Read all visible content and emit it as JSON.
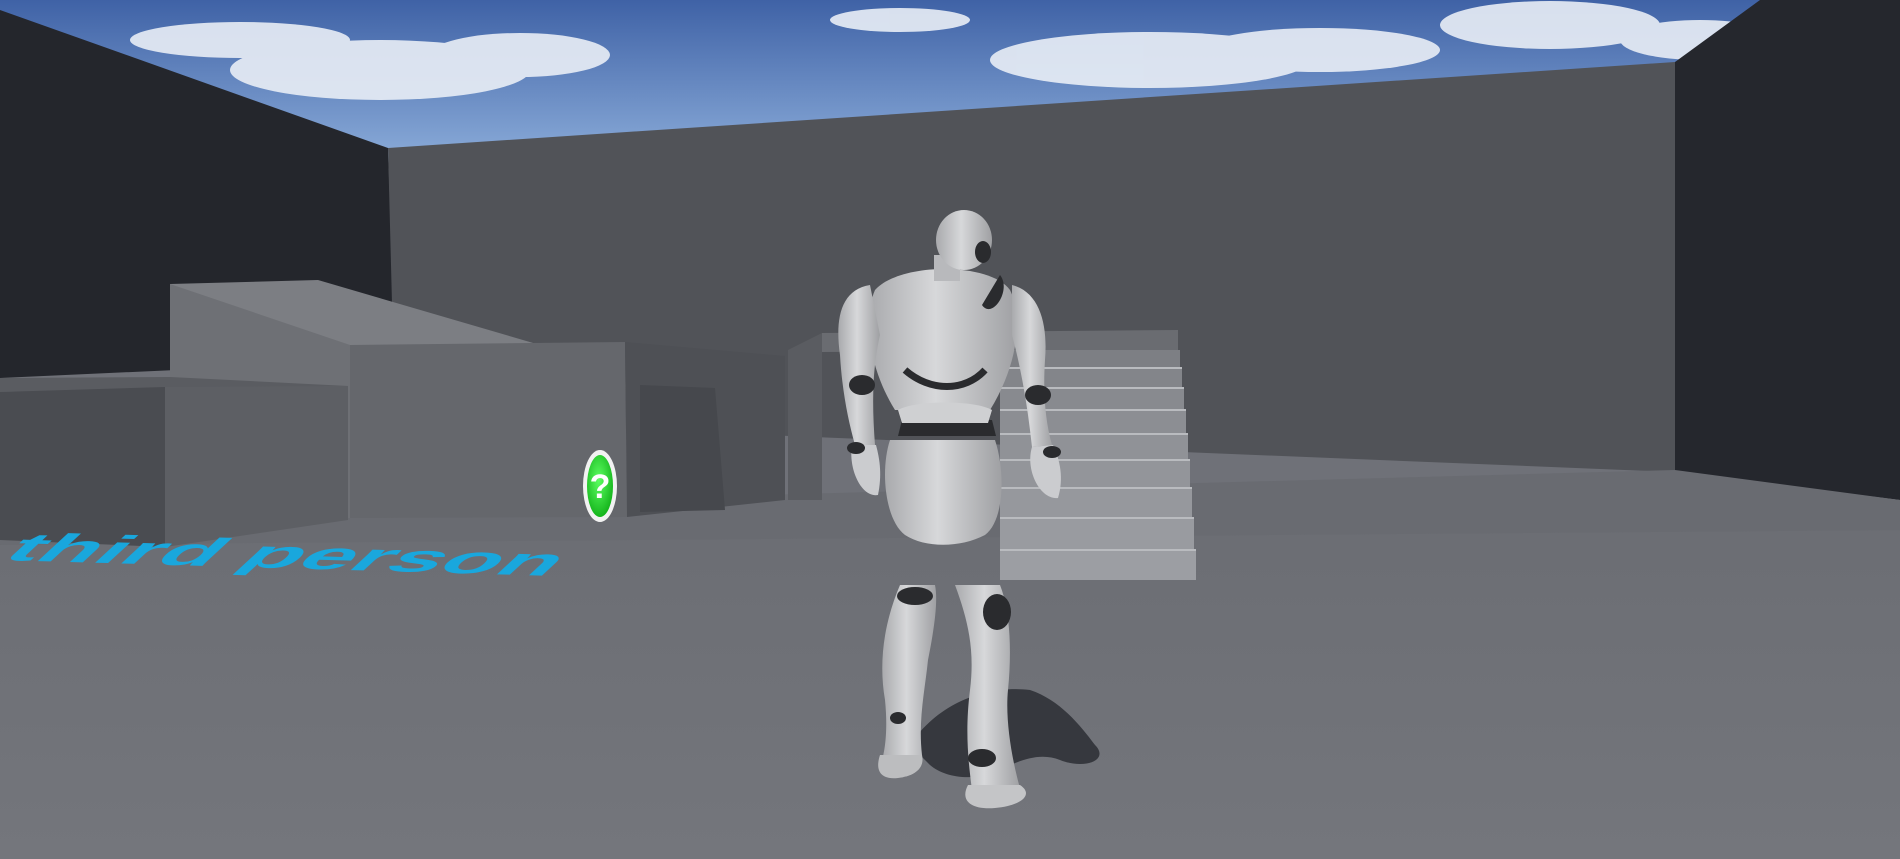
{
  "scene": {
    "floor_text": "third person",
    "marker_glyph": "?",
    "colors": {
      "sky_top": "#3f62a6",
      "sky_bottom": "#8fb0dc",
      "wall_back": "#515358",
      "wall_side_dark": "#24262c",
      "floor": "#6f7178",
      "block": "#5d5f64",
      "ramp": "#7c7e83",
      "stairs": "#8a8c91",
      "floor_text": "#19a7dd",
      "marker_green": "#27d62f",
      "mannequin": "#c9cacc",
      "mannequin_joint": "#2a2b2e"
    }
  }
}
